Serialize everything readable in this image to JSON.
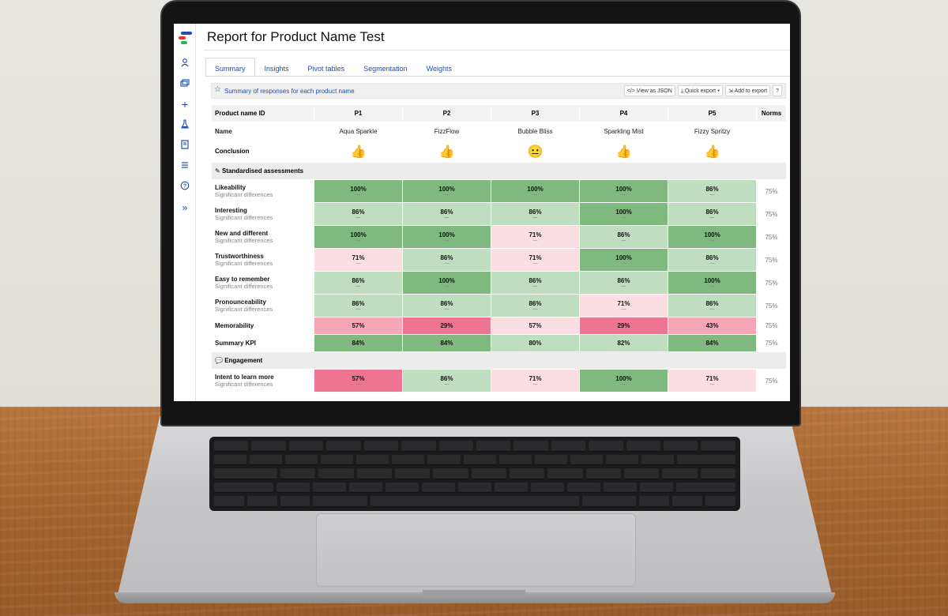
{
  "app": {
    "title": "Report for Product Name Test"
  },
  "tabs": [
    {
      "label": "Summary",
      "active": true
    },
    {
      "label": "Insights"
    },
    {
      "label": "Pivot tables"
    },
    {
      "label": "Segmentation"
    },
    {
      "label": "Weights"
    }
  ],
  "sidebar": {
    "icons": [
      "user-icon",
      "stack-icon",
      "plus-icon",
      "flask-icon",
      "book-icon",
      "menu-icon",
      "help-icon",
      "expand-icon"
    ]
  },
  "panel": {
    "title": "Summary of responses for each product name",
    "buttons": {
      "json": "View as JSON",
      "export": "Quick export",
      "add": "Add to export"
    }
  },
  "table": {
    "header_label": "Product name ID",
    "norms_label": "Norms",
    "products": [
      {
        "id": "P1",
        "name": "Aqua Sparkle",
        "conclusion": "thumbs-up"
      },
      {
        "id": "P2",
        "name": "FizzFlow",
        "conclusion": "thumbs-up"
      },
      {
        "id": "P3",
        "name": "Bubble Bliss",
        "conclusion": "neutral-face"
      },
      {
        "id": "P4",
        "name": "Sparkling Mist",
        "conclusion": "thumbs-up"
      },
      {
        "id": "P5",
        "name": "Fizzy Spritzy",
        "conclusion": "thumbs-up"
      }
    ],
    "name_label": "Name",
    "conclusion_label": "Conclusion",
    "sections": [
      {
        "title": "Standardised assessments",
        "icon": "edit-icon",
        "rows": [
          {
            "label": "Likeability",
            "sub": "Significant differences",
            "values": [
              "100%",
              "100%",
              "100%",
              "100%",
              "86%"
            ],
            "levels": [
              "dg",
              "dg",
              "dg",
              "dg",
              "lg"
            ],
            "norm": "75%"
          },
          {
            "label": "Interesting",
            "sub": "Significant differences",
            "values": [
              "86%",
              "86%",
              "86%",
              "100%",
              "86%"
            ],
            "levels": [
              "lg",
              "lg",
              "lg",
              "dg",
              "lg"
            ],
            "norm": "75%"
          },
          {
            "label": "New and different",
            "sub": "Significant differences",
            "values": [
              "100%",
              "100%",
              "71%",
              "86%",
              "100%"
            ],
            "levels": [
              "dg",
              "dg",
              "lp",
              "lg",
              "dg"
            ],
            "norm": "75%"
          },
          {
            "label": "Trustworthiness",
            "sub": "Significant differences",
            "values": [
              "71%",
              "86%",
              "71%",
              "100%",
              "86%"
            ],
            "levels": [
              "lp",
              "lg",
              "lp",
              "dg",
              "lg"
            ],
            "norm": "75%"
          },
          {
            "label": "Easy to remember",
            "sub": "Significant differences",
            "values": [
              "86%",
              "100%",
              "86%",
              "86%",
              "100%"
            ],
            "levels": [
              "lg",
              "dg",
              "lg",
              "lg",
              "dg"
            ],
            "norm": "75%"
          },
          {
            "label": "Pronounceability",
            "sub": "Significant differences",
            "values": [
              "86%",
              "86%",
              "86%",
              "71%",
              "86%"
            ],
            "levels": [
              "lg",
              "lg",
              "lg",
              "lp",
              "lg"
            ],
            "norm": "75%"
          },
          {
            "label": "Memorability",
            "sub": "",
            "values": [
              "57%",
              "29%",
              "57%",
              "29%",
              "43%"
            ],
            "levels": [
              "mp",
              "dp",
              "lp",
              "dp",
              "mp"
            ],
            "norm": "75%"
          },
          {
            "label": "Summary KPI",
            "sub": "",
            "values": [
              "84%",
              "84%",
              "80%",
              "82%",
              "84%"
            ],
            "levels": [
              "dg",
              "dg",
              "lg",
              "lg",
              "dg"
            ],
            "norm": "75%"
          }
        ]
      },
      {
        "title": "Engagement",
        "icon": "chat-icon",
        "rows": [
          {
            "label": "Intent to learn more",
            "sub": "Significant differences",
            "values": [
              "57%",
              "86%",
              "71%",
              "100%",
              "71%"
            ],
            "levels": [
              "dp",
              "lg",
              "lp",
              "dg",
              "lp"
            ],
            "norm": "75%"
          }
        ]
      }
    ]
  }
}
